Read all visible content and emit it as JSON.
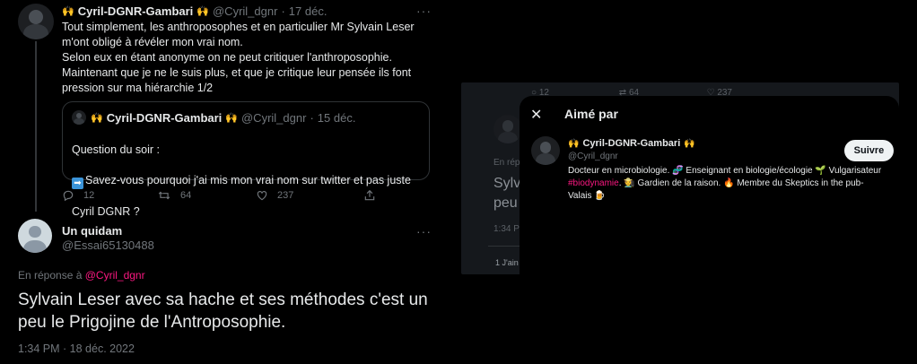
{
  "main_tweet": {
    "author_name": "Cyril-DGNR-Gambari",
    "handle": "@Cyril_dgnr",
    "separator": "·",
    "date": "17 déc.",
    "text": "Tout simplement, les anthroposophes et en particulier Mr Sylvain Leser\nm'ont obligé à révéler mon vrai nom.\nSelon eux en étant anonyme on ne peut critiquer l'anthroposophie.\nMaintenant que je ne le suis plus, et que je critique leur pensée ils font\npression sur ma hiérarchie 1/2",
    "more_label": "···",
    "quoted": {
      "author_name": "Cyril-DGNR-Gambari",
      "handle": "@Cyril_dgnr",
      "separator": "·",
      "date": "15 déc.",
      "line1": "Question du soir :",
      "line2": "Savez-vous pourquoi j'ai mis mon vrai nom sur twitter et pas juste",
      "line3": "Cyril DGNR ?"
    },
    "counts": {
      "replies": "12",
      "retweets": "64",
      "likes": "237"
    }
  },
  "reply_tweet": {
    "author_name": "Un quidam",
    "handle": "@Essai65130488",
    "more_label": "···",
    "reply_prefix": "En réponse à",
    "reply_handle": "@Cyril_dgnr",
    "text": "Sylvain Leser avec sa hache et ses méthodes c'est un\npeu le Prigojine de l'Antroposophie.",
    "timestamp": "1:34 PM · 18 déc. 2022"
  },
  "background_panel": {
    "counts": {
      "replies": "12",
      "retweets": "64",
      "likes": "237"
    },
    "fragment_reply": "En rép",
    "fragment_text1": "Sylv",
    "fragment_text2": "peu",
    "fragment_time": "1:34 P",
    "fragment_likes": "1 J'ain"
  },
  "liked_by_modal": {
    "close_label": "✕",
    "title": "Aimé par",
    "user": {
      "name": "Cyril-DGNR-Gambari",
      "handle": "@Cyril_dgnr",
      "follow_label": "Suivre",
      "bio_part1": "Docteur en microbiologie. 🧬 Enseignant en biologie/écologie 🌱",
      "bio_part2": "Vulgarisateur",
      "bio_hashtag": "#biodynamie",
      "bio_part3": ". 🧑‍🌾 Gardien de la raison. 🔥 Membre du Skeptics in the pub-Valais 🍺"
    }
  },
  "colors": {
    "background": "#000000",
    "text": "#e7e9ea",
    "muted": "#71767b",
    "link_pink": "#f91880",
    "border": "#2f3336"
  }
}
